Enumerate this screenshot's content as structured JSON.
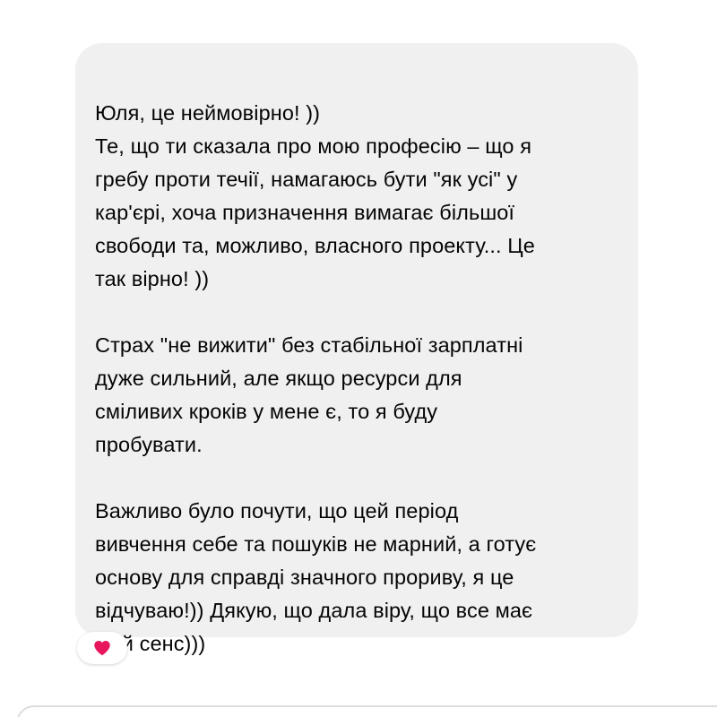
{
  "message": {
    "paragraphs": [
      {
        "lines": [
          "Юля, це неймовірно! ))",
          "Те, що ти сказала про мою професію – що я",
          "гребу проти течії, намагаюсь бути \"як усі\" у",
          "кар'єрі, хоча призначення вимагає більшої",
          "свободи та, можливо, власного проекту... Це",
          "так вірно! ))"
        ]
      },
      {
        "lines": [
          "Страх \"не вижити\" без стабільної зарплатні",
          "дуже сильний, але якщо ресурси для",
          "сміливих кроків у мене є, то я буду",
          "пробувати."
        ]
      },
      {
        "lines": [
          "Важливо було почути, що цей період",
          "вивчення себе та пошуків не марний, а готує",
          "основу для справді значного прориву, я це",
          "відчуваю!)) Дякую, що дала віру, що все має",
          "свій сенс)))"
        ]
      }
    ]
  },
  "reaction": {
    "icon": "heart-icon",
    "color": "#e8175d"
  },
  "colors": {
    "bubble_background": "#f0f0f0",
    "text": "#050505"
  }
}
